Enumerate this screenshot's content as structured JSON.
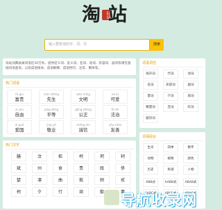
{
  "logo": {
    "char1": "淘",
    "seal": "好站",
    "char2": "站"
  },
  "search": {
    "placeholder": "输入要查询的字、词、句",
    "button": "搜索"
  },
  "intro": "淘站词典收录词语近30万条，提供近义词、反义词、名词、动词、形容词、副词等课堂基础词语查询，以及成语接龙、成语解释、成语例句、注音、繁体等。",
  "hot_words": {
    "title": "热门词语",
    "items": [
      {
        "py": "fù guì",
        "zi": "富贵"
      },
      {
        "py": "xiān shēng",
        "zi": "先生"
      },
      {
        "py": "wén míng",
        "zi": "文明"
      },
      {
        "py": "kě ài",
        "zi": "可爱"
      },
      {
        "py": "zì yóu",
        "zi": "自由"
      },
      {
        "py": "píng děng",
        "zi": "平等"
      },
      {
        "py": "gōng zhèng",
        "zi": "公正"
      },
      {
        "py": "fǎ zhì",
        "zi": "法治"
      },
      {
        "py": "ài guó",
        "zi": "爱国"
      },
      {
        "py": "jìng yè",
        "zi": "敬业"
      },
      {
        "py": "chéng xìn",
        "zi": "诚信"
      },
      {
        "py": "yǒu shàn",
        "zi": "友善"
      }
    ]
  },
  "hot_chars": {
    "title": "热门汉字",
    "items": [
      "膳",
      "汶",
      "栢",
      "柯",
      "珂",
      "轲",
      "斌",
      "州",
      "食",
      "责",
      "既",
      "侈",
      "婪",
      "凛",
      "曲",
      "栽",
      "舸",
      "贰",
      "柯",
      "夕",
      "行",
      "琦",
      "歙",
      "粟"
    ]
  },
  "word_classes": {
    "title": "词语词性",
    "items": [
      "拟声词",
      "代词",
      "动词",
      "名词",
      "形容词",
      "副词",
      "量词",
      "介词",
      "助词",
      "数量词",
      "连词",
      "叹词",
      "疑问词"
    ]
  },
  "word_structure": {
    "title": "词语组合",
    "items": [
      "ABB式",
      "AABB式",
      "ABAB式",
      "AABC式",
      "ABCC式",
      "ABAC式"
    ],
    "categories": [
      "生肖",
      "四季",
      "数字",
      "动物",
      "植物",
      "颜色",
      "历史",
      "称谓",
      "人物"
    ]
  },
  "watermark": {
    "text": "导航收录网",
    "url": "www.daohangshoulu.com"
  }
}
